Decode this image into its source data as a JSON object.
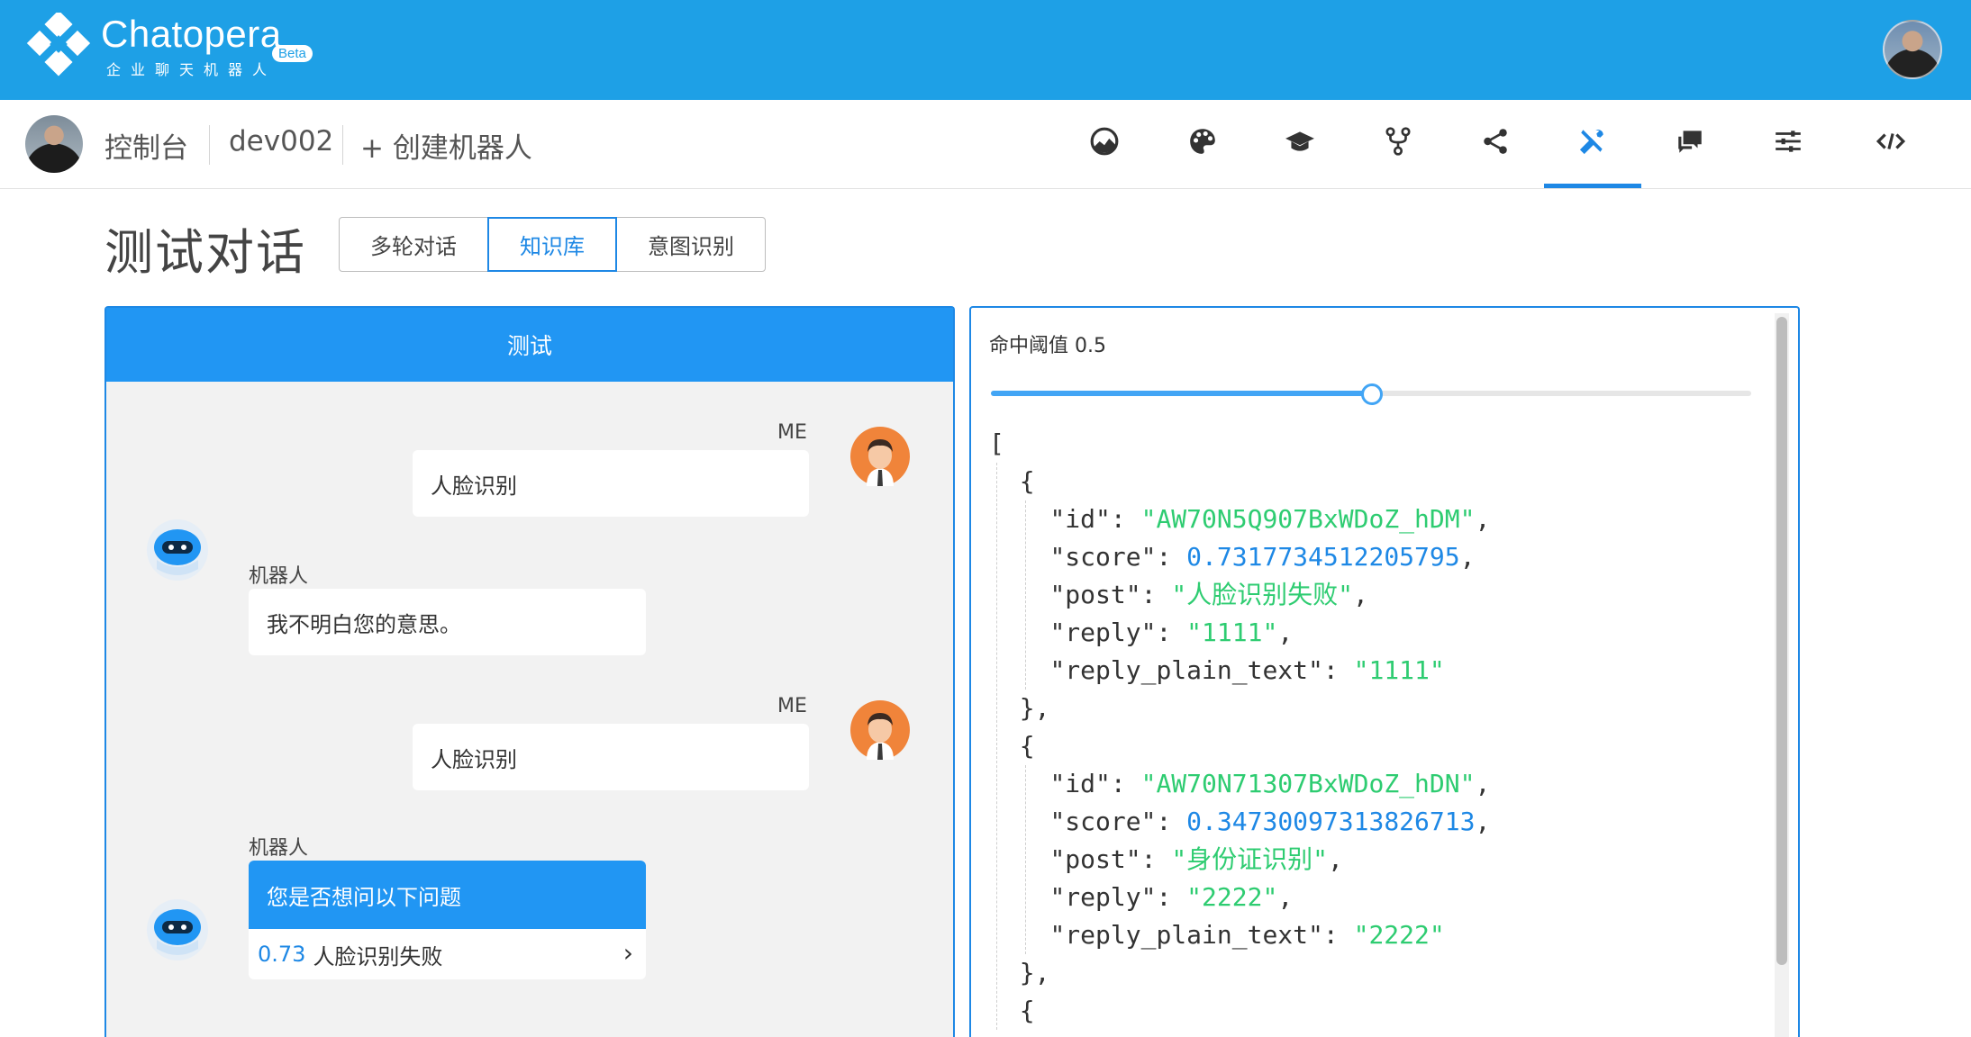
{
  "brand": {
    "name": "Chatopera",
    "badge": "Beta",
    "subtitle": "企业聊天机器人"
  },
  "subnav": {
    "console": "控制台",
    "bot_name": "dev002",
    "create_bot": "+ 创建机器人",
    "icons": [
      "dashboard-icon",
      "palette-icon",
      "graduation-cap-icon",
      "fork-icon",
      "share-icon",
      "tools-icon",
      "chat-icon",
      "sliders-icon",
      "code-icon"
    ],
    "active_icon": "tools-icon"
  },
  "page": {
    "title": "测试对话",
    "tabs": [
      "多轮对话",
      "知识库",
      "意图识别"
    ],
    "active_tab": "知识库"
  },
  "chat": {
    "header": "测试",
    "messages": [
      {
        "from": "ME",
        "text": "人脸识别"
      },
      {
        "from": "机器人",
        "text": "我不明白您的意思。"
      },
      {
        "from": "ME",
        "text": "人脸识别"
      },
      {
        "from": "机器人",
        "prompt": "您是否想问以下问题",
        "choices": [
          {
            "score": "0.73",
            "text": "人脸识别失败"
          }
        ]
      }
    ]
  },
  "result": {
    "threshold_label": "命中阈值 0.5",
    "threshold_value": 0.5,
    "json_lines": [
      "[",
      "  {",
      "    \"id\": \"AW70N5Q907BxWDoZ_hDM\",",
      "    \"score\": 0.7317734512205795,",
      "    \"post\": \"人脸识别失败\",",
      "    \"reply\": \"1111\",",
      "    \"reply_plain_text\": \"1111\"",
      "  },",
      "  {",
      "    \"id\": \"AW70N71307BxWDoZ_hDN\",",
      "    \"score\": 0.34730097313826713,",
      "    \"post\": \"身份证识别\",",
      "    \"reply\": \"2222\",",
      "    \"reply_plain_text\": \"2222\"",
      "  },",
      "  {"
    ]
  },
  "colors": {
    "brand_bar": "#1ea0e6",
    "accent": "#1e88e5",
    "json_string": "#2ecc71",
    "json_number": "#1e88e5"
  }
}
